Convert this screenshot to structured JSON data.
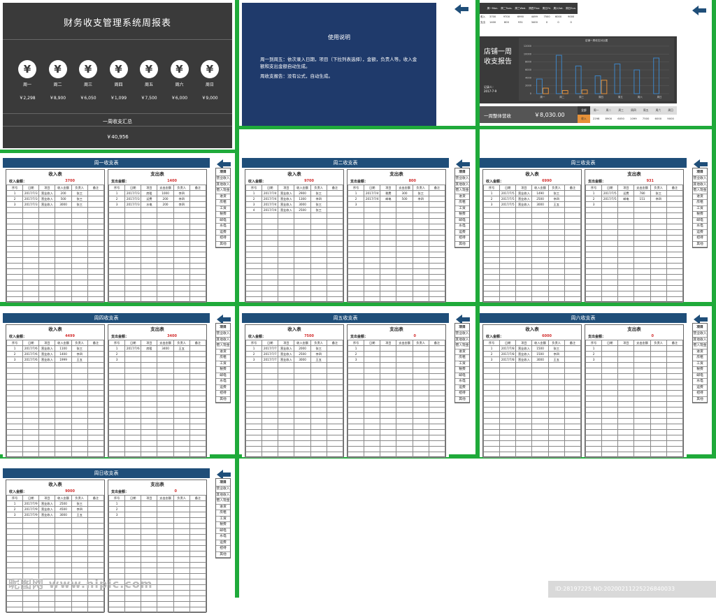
{
  "dashboard": {
    "title": "财务收支管理系统周报表",
    "days": [
      {
        "label": "周一",
        "amount": "￥2,298"
      },
      {
        "label": "周二",
        "amount": "￥8,900"
      },
      {
        "label": "周三",
        "amount": "￥6,050"
      },
      {
        "label": "周四",
        "amount": "￥1,099"
      },
      {
        "label": "周五",
        "amount": "￥7,500"
      },
      {
        "label": "周六",
        "amount": "￥6,000"
      },
      {
        "label": "周日",
        "amount": "￥9,000"
      }
    ],
    "coin_glyph": "¥",
    "summary_label": "一周收支汇总",
    "summary_value": "￥40,956"
  },
  "usage": {
    "heading": "使用说明",
    "line1": "周一到周五：依次录入日期，项目（下拉列表选择），金额，负责人等。收入金额和支出金额自动生成。",
    "line2": "周收支报告：没有公式，自动生成。"
  },
  "report": {
    "header_days": [
      "周一Mon.",
      "周二Tues.",
      "周三Wed.",
      "周四Thur.",
      "周五Fri.",
      "周六Sat.",
      "周日Sun."
    ],
    "row_income": [
      "收入",
      "3700",
      "9700",
      "6990",
      "4499",
      "7500",
      "6000",
      "9000"
    ],
    "row_expense": [
      "支出",
      "1400",
      "800",
      "931",
      "3400",
      "0",
      "0",
      "0"
    ],
    "title": "店铺一周收支报告",
    "date_label": "记录人：",
    "date_value": "2017-7-9",
    "chart_title": "店铺一周收支对比图",
    "total_label": "一周整体营收",
    "total_value": "￥8,030.00",
    "bottom_days": [
      "全部",
      "周一",
      "周二",
      "周三",
      "周四",
      "周五",
      "周六",
      "周日"
    ],
    "bottom_vals": [
      "收入",
      "2298",
      "8900",
      "6050",
      "1099",
      "7500",
      "6000",
      "9000"
    ]
  },
  "chart_data": {
    "type": "bar",
    "title": "店铺一周收支对比图",
    "categories": [
      "周一",
      "周二",
      "周三",
      "周四",
      "周五",
      "周六",
      "周日"
    ],
    "series": [
      {
        "name": "收入",
        "values": [
          3700,
          9700,
          6990,
          4499,
          7500,
          6000,
          9000
        ]
      },
      {
        "name": "支出",
        "values": [
          1400,
          800,
          931,
          3400,
          0,
          0,
          0
        ]
      }
    ],
    "ylim": [
      0,
      12000
    ],
    "colors": {
      "income": "#3d85c6",
      "expense": "#e69138"
    }
  },
  "sidebar": {
    "header": "项目",
    "items": [
      "营业收入",
      "其他收入",
      "借入现金",
      "进货",
      "房租",
      "工资",
      "税费",
      "邮电",
      "水电",
      "运费",
      "招待",
      "其他"
    ]
  },
  "labels": {
    "income_table": "收入表",
    "expense_table": "支出表",
    "income_amount": "收入金额：",
    "expense_amount": "支出金额：",
    "income_cols": [
      "序号",
      "日期",
      "项目",
      "收入金额",
      "负责人",
      "备注"
    ],
    "expense_cols": [
      "序号",
      "日期",
      "项目",
      "支出金额",
      "负责人",
      "备注"
    ]
  },
  "weeks": [
    {
      "title": "周一收支表",
      "income_total": "3700",
      "expense_total": "1400",
      "income_rows": [
        [
          "1",
          "2017/7/3",
          "营业收入",
          "200",
          "张三",
          ""
        ],
        [
          "2",
          "2017/7/3",
          "营业收入",
          "500",
          "张三",
          ""
        ],
        [
          "3",
          "2017/7/3",
          "营业收入",
          "3000",
          "张三",
          ""
        ]
      ],
      "expense_rows": [
        [
          "1",
          "2017/7/3",
          "房租",
          "1000",
          "李四",
          ""
        ],
        [
          "2",
          "2017/7/3",
          "运费",
          "200",
          "李四",
          ""
        ],
        [
          "3",
          "2017/7/3",
          "水电",
          "200",
          "李四",
          ""
        ]
      ]
    },
    {
      "title": "周二收支表",
      "income_total": "9700",
      "expense_total": "800",
      "income_rows": [
        [
          "1",
          "2017/7/4",
          "营业收入",
          "2900",
          "张三",
          ""
        ],
        [
          "2",
          "2017/7/4",
          "营业收入",
          "1300",
          "李四",
          ""
        ],
        [
          "3",
          "2017/7/4",
          "营业收入",
          "3000",
          "张三",
          ""
        ],
        [
          "4",
          "2017/7/4",
          "营业收入",
          "2500",
          "张三",
          ""
        ]
      ],
      "expense_rows": [
        [
          "1",
          "2017/7/4",
          "税费",
          "300",
          "张三",
          ""
        ],
        [
          "2",
          "2017/7/4",
          "邮电",
          "500",
          "李四",
          ""
        ],
        [
          "3",
          "",
          "",
          "",
          "",
          ""
        ]
      ]
    },
    {
      "title": "周三收支表",
      "income_total": "6990",
      "expense_total": "931",
      "income_rows": [
        [
          "1",
          "2017/7/5",
          "营业收入",
          "1490",
          "张三",
          ""
        ],
        [
          "2",
          "2017/7/5",
          "营业收入",
          "2500",
          "李四",
          ""
        ],
        [
          "3",
          "2017/7/5",
          "营业收入",
          "3000",
          "王五",
          ""
        ]
      ],
      "expense_rows": [
        [
          "1",
          "2017/7/5",
          "运费",
          "780",
          "张三",
          ""
        ],
        [
          "2",
          "2017/7/5",
          "邮电",
          "151",
          "李四",
          ""
        ],
        [
          "3",
          "",
          "",
          "",
          "",
          ""
        ]
      ]
    },
    {
      "title": "周四收支表",
      "income_total": "4499",
      "expense_total": "3400",
      "income_rows": [
        [
          "1",
          "2017/7/6",
          "营业收入",
          "1100",
          "张三",
          ""
        ],
        [
          "2",
          "2017/7/6",
          "营业收入",
          "1400",
          "李四",
          ""
        ],
        [
          "3",
          "2017/7/6",
          "营业收入",
          "1999",
          "王五",
          ""
        ]
      ],
      "expense_rows": [
        [
          "1",
          "2017/7/6",
          "房租",
          "3400",
          "王五",
          ""
        ],
        [
          "2",
          "",
          "",
          "",
          "",
          ""
        ],
        [
          "3",
          "",
          "",
          "",
          "",
          ""
        ]
      ]
    },
    {
      "title": "周五收支表",
      "income_total": "7500",
      "expense_total": "0",
      "income_rows": [
        [
          "1",
          "2017/7/7",
          "营业收入",
          "2000",
          "张三",
          ""
        ],
        [
          "2",
          "2017/7/7",
          "营业收入",
          "2500",
          "李四",
          ""
        ],
        [
          "3",
          "2017/7/7",
          "营业收入",
          "3000",
          "王五",
          ""
        ]
      ],
      "expense_rows": [
        [
          "1",
          "",
          "",
          "",
          "",
          ""
        ],
        [
          "2",
          "",
          "",
          "",
          "",
          ""
        ],
        [
          "3",
          "",
          "",
          "",
          "",
          ""
        ]
      ]
    },
    {
      "title": "周六收支表",
      "income_total": "6000",
      "expense_total": "0",
      "income_rows": [
        [
          "1",
          "2017/7/8",
          "营业收入",
          "1500",
          "张三",
          ""
        ],
        [
          "2",
          "2017/7/8",
          "营业收入",
          "1500",
          "李四",
          ""
        ],
        [
          "3",
          "2017/7/8",
          "营业收入",
          "3000",
          "王五",
          ""
        ]
      ],
      "expense_rows": [
        [
          "1",
          "",
          "",
          "",
          "",
          ""
        ],
        [
          "2",
          "",
          "",
          "",
          "",
          ""
        ],
        [
          "3",
          "",
          "",
          "",
          "",
          ""
        ]
      ]
    },
    {
      "title": "周日收支表",
      "income_total": "9000",
      "expense_total": "0",
      "income_rows": [
        [
          "1",
          "2017/7/9",
          "营业收入",
          "2500",
          "张三",
          ""
        ],
        [
          "2",
          "2017/7/9",
          "营业收入",
          "4500",
          "李四",
          ""
        ],
        [
          "3",
          "2017/7/9",
          "营业收入",
          "3000",
          "王五",
          ""
        ]
      ],
      "expense_rows": [
        [
          "1",
          "",
          "",
          "",
          "",
          ""
        ],
        [
          "2",
          "",
          "",
          "",
          "",
          ""
        ],
        [
          "3",
          "",
          "",
          "",
          "",
          ""
        ]
      ]
    }
  ],
  "watermark": {
    "left": "昵图网 www.nipic.com",
    "right": "ID:28197225 NO:20200211225226840033"
  }
}
